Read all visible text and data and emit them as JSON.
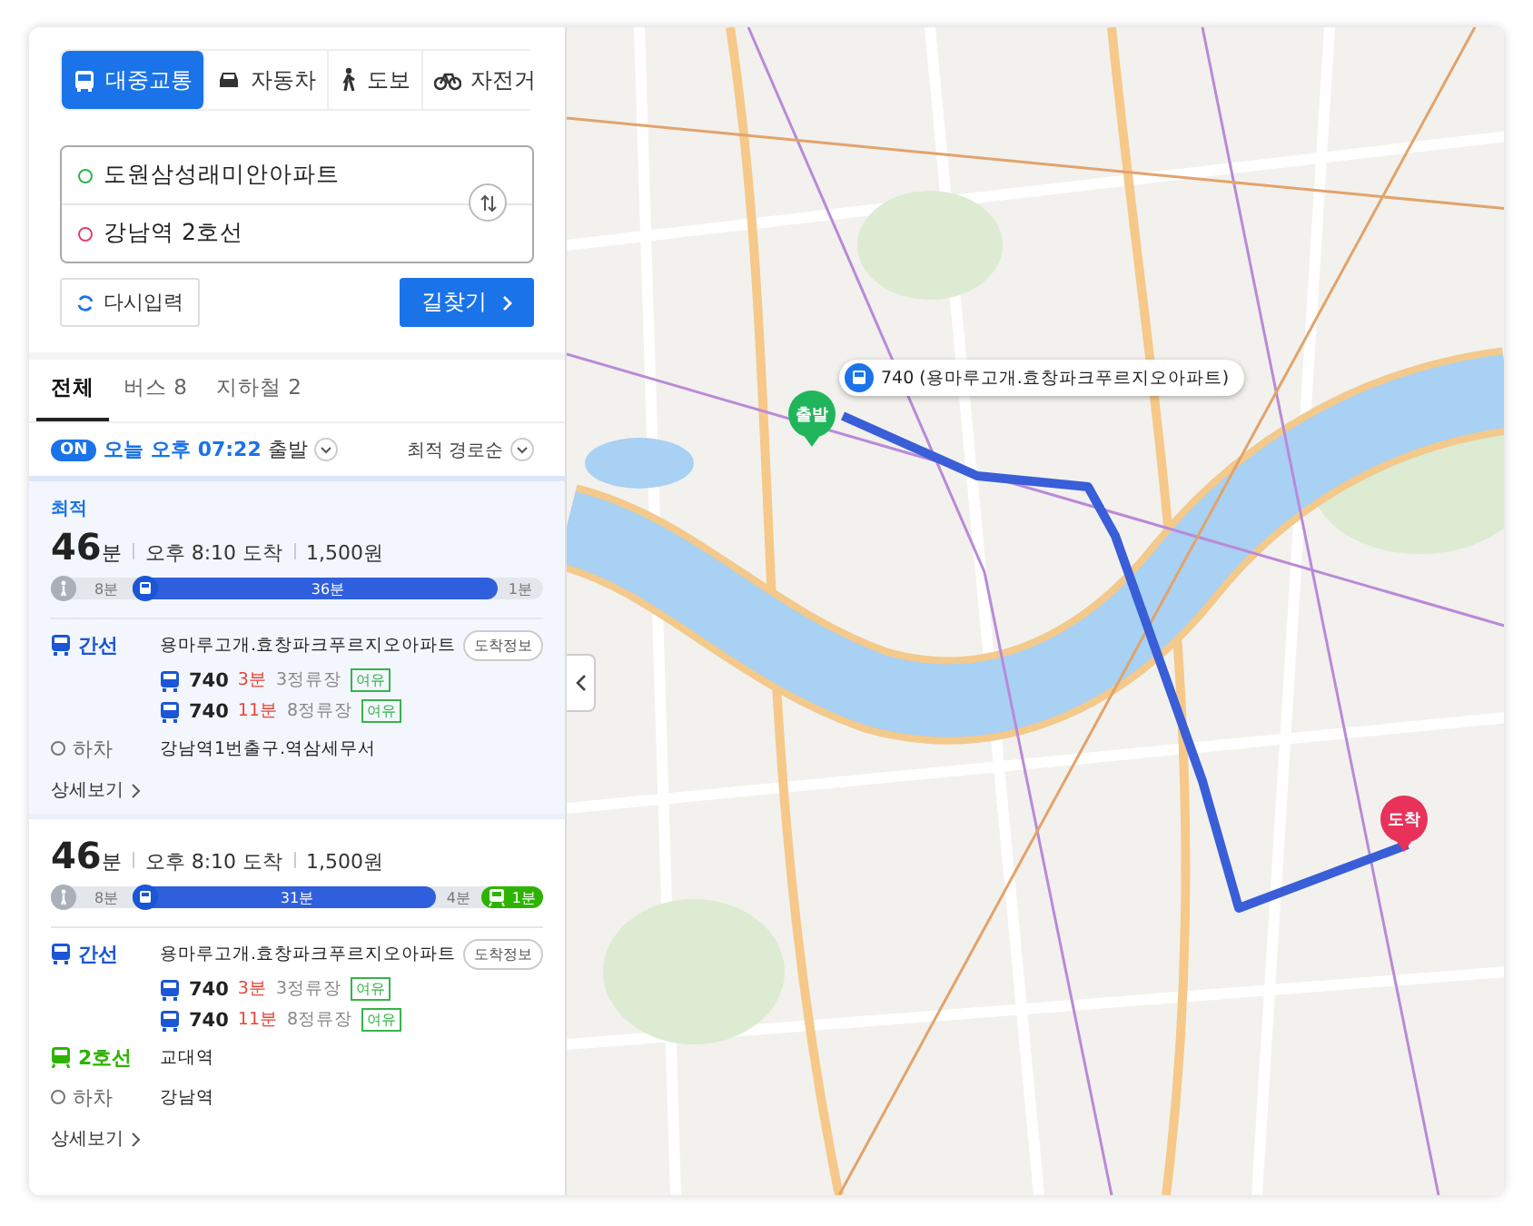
{
  "modes": [
    {
      "kind": "transit",
      "label": "대중교통",
      "selected": true
    },
    {
      "kind": "car",
      "label": "자동차",
      "selected": false
    },
    {
      "kind": "walk",
      "label": "도보",
      "selected": false
    },
    {
      "kind": "bike",
      "label": "자전거",
      "selected": false
    }
  ],
  "route_inputs": {
    "origin": "도원삼성래미안아파트",
    "destination": "강남역 2호선"
  },
  "reset_button": "다시입력",
  "search_button": "길찾기",
  "tabs": [
    {
      "label": "전체",
      "selected": true
    },
    {
      "label": "버스 8",
      "selected": false
    },
    {
      "label": "지하철 2",
      "selected": false
    }
  ],
  "departure": {
    "badge": "ON",
    "on": true,
    "time": "오늘 오후 07:22",
    "suffix": "출발",
    "sort": "최적 경로순"
  },
  "routes": [
    {
      "tag": "최적",
      "highlighted": true,
      "duration": "46",
      "unit": "분",
      "arrival": "오후 8:10 도착",
      "fare": "1,500원",
      "segments": [
        {
          "kind": "walk",
          "label": "8분"
        },
        {
          "kind": "bus",
          "label": "36분"
        },
        {
          "kind": "walk_end",
          "label": "1분"
        }
      ],
      "steps": [
        {
          "kind": "bus",
          "line": "간선",
          "stop": "용마루고개.효창파크푸르지오아파트",
          "button": "도착정보",
          "buses": [
            {
              "number": "740",
              "eta": "3분",
              "stops": "3정류장",
              "status": "여유"
            },
            {
              "number": "740",
              "eta": "11분",
              "stops": "8정류장",
              "status": "여유"
            }
          ]
        },
        {
          "kind": "alight",
          "line": "하차",
          "stop": "강남역1번출구.역삼세무서"
        }
      ],
      "details": "상세보기"
    },
    {
      "highlighted": false,
      "duration": "46",
      "unit": "분",
      "arrival": "오후 8:10 도착",
      "fare": "1,500원",
      "segments": [
        {
          "kind": "walk",
          "label": "8분"
        },
        {
          "kind": "bus",
          "label": "31분"
        },
        {
          "kind": "walk_end",
          "label": "4분"
        },
        {
          "kind": "subway",
          "label": "1분"
        }
      ],
      "steps": [
        {
          "kind": "bus",
          "line": "간선",
          "stop": "용마루고개.효창파크푸르지오아파트",
          "button": "도착정보",
          "buses": [
            {
              "number": "740",
              "eta": "3분",
              "stops": "3정류장",
              "status": "여유"
            },
            {
              "number": "740",
              "eta": "11분",
              "stops": "8정류장",
              "status": "여유"
            }
          ]
        },
        {
          "kind": "subway",
          "line": "2호선",
          "stop": "교대역"
        },
        {
          "kind": "alight",
          "line": "하차",
          "stop": "강남역"
        }
      ],
      "details": "상세보기"
    }
  ],
  "map": {
    "callout": "740 (용마루고개.효창파크푸르지오아파트)",
    "start_pin": "출발",
    "end_pin": "도착"
  }
}
